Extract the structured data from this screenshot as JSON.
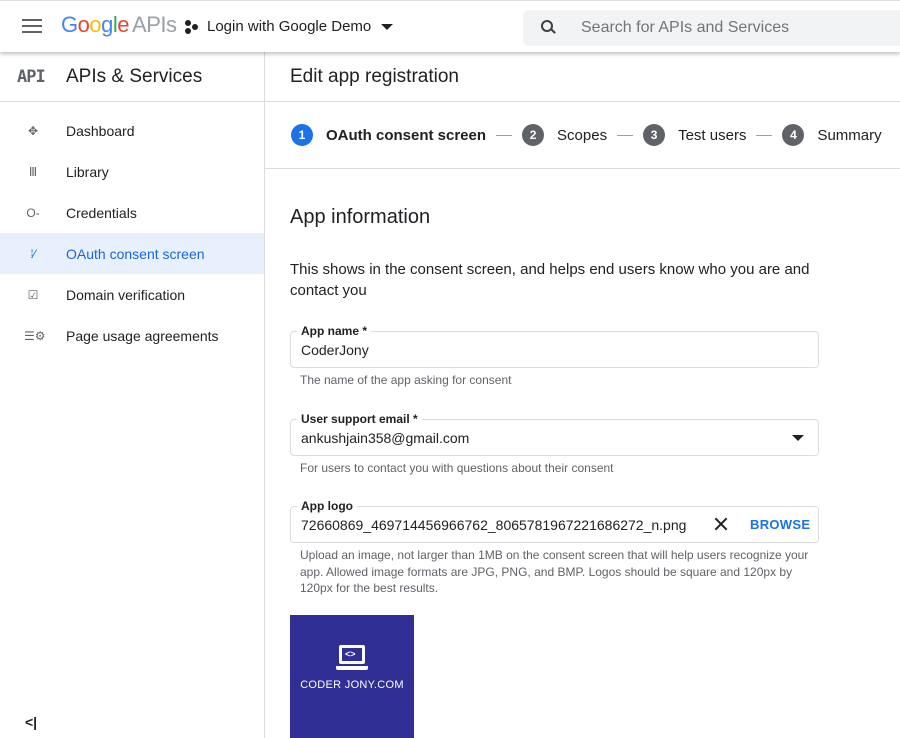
{
  "topbar": {
    "brand": {
      "google": "Google",
      "apis": "APIs"
    },
    "project_name": "Login with Google Demo",
    "search_placeholder": "Search for APIs and Services"
  },
  "sidebar": {
    "header_icon": "API",
    "title": "APIs & Services",
    "items": [
      {
        "label": "Dashboard",
        "icon": "dashboard-icon",
        "active": false
      },
      {
        "label": "Library",
        "icon": "library-icon",
        "active": false
      },
      {
        "label": "Credentials",
        "icon": "key-icon",
        "active": false
      },
      {
        "label": "OAuth consent screen",
        "icon": "consent-icon",
        "active": true
      },
      {
        "label": "Domain verification",
        "icon": "checkbox-icon",
        "active": false
      },
      {
        "label": "Page usage agreements",
        "icon": "settings-list-icon",
        "active": false
      }
    ],
    "collapse_glyph": "<|"
  },
  "main": {
    "page_title": "Edit app registration",
    "steps": [
      {
        "num": "1",
        "label": "OAuth consent screen",
        "active": true
      },
      {
        "num": "2",
        "label": "Scopes",
        "active": false
      },
      {
        "num": "3",
        "label": "Test users",
        "active": false
      },
      {
        "num": "4",
        "label": "Summary",
        "active": false
      }
    ],
    "section_title": "App information",
    "section_desc": "This shows in the consent screen, and helps end users know who you are and contact you",
    "fields": {
      "app_name": {
        "label": "App name *",
        "value": "CoderJony",
        "hint": "The name of the app asking for consent"
      },
      "support_email": {
        "label": "User support email *",
        "value": "ankushjain358@gmail.com",
        "hint": "For users to contact you with questions about their consent"
      },
      "app_logo": {
        "label": "App logo",
        "value": "72660869_469714456966762_8065781967221686272_n.png",
        "browse": "BROWSE",
        "hint": "Upload an image, not larger than 1MB on the consent screen that will help users recognize your app. Allowed image formats are JPG, PNG, and BMP. Logos should be square and 120px by 120px for the best results."
      }
    },
    "logo_preview": {
      "code_glyph": "<>",
      "text": "CODER JONY.COM",
      "bg_color": "#2f2f96"
    }
  }
}
